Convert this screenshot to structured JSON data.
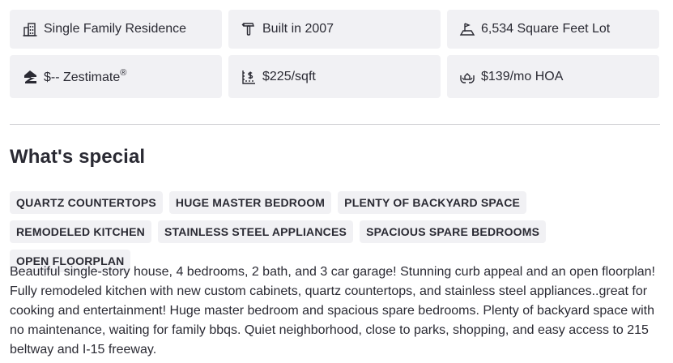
{
  "facts": [
    {
      "icon": "building-icon",
      "label": "Single Family Residence"
    },
    {
      "icon": "hammer-icon",
      "label": "Built in 2007"
    },
    {
      "icon": "lot-size-icon",
      "label": "6,534 Square Feet Lot"
    },
    {
      "icon": "zestimate-logo-icon",
      "label": "$-- Zestimate",
      "suffix": "®"
    },
    {
      "icon": "price-per-sqft-icon",
      "label": "$225/sqft"
    },
    {
      "icon": "hoa-hands-house-icon",
      "label": "$139/mo HOA"
    }
  ],
  "special": {
    "heading": "What's special",
    "tags": [
      "QUARTZ COUNTERTOPS",
      "HUGE MASTER BEDROOM",
      "PLENTY OF BACKYARD SPACE",
      "REMODELED KITCHEN",
      "STAINLESS STEEL APPLIANCES",
      "SPACIOUS SPARE BEDROOMS",
      "OPEN FLOORPLAN"
    ],
    "description": "Beautiful single-story house, 4 bedrooms, 2 bath, and 3 car garage! Stunning curb appeal and an open floorplan! Fully remodeled kitchen with new custom cabinets, quartz countertops, and stainless steel appliances..great for cooking and entertainment! Huge master bedroom and spacious spare bedrooms. Plenty of backyard space with no maintenance, waiting for family bbqs. Quiet neighborhood, close to parks, shopping, and easy access to 215 beltway and I-15 freeway."
  },
  "colors": {
    "card_bg": "#f1f1f4",
    "text": "#2a2a33",
    "divider": "#d1d1d5"
  }
}
